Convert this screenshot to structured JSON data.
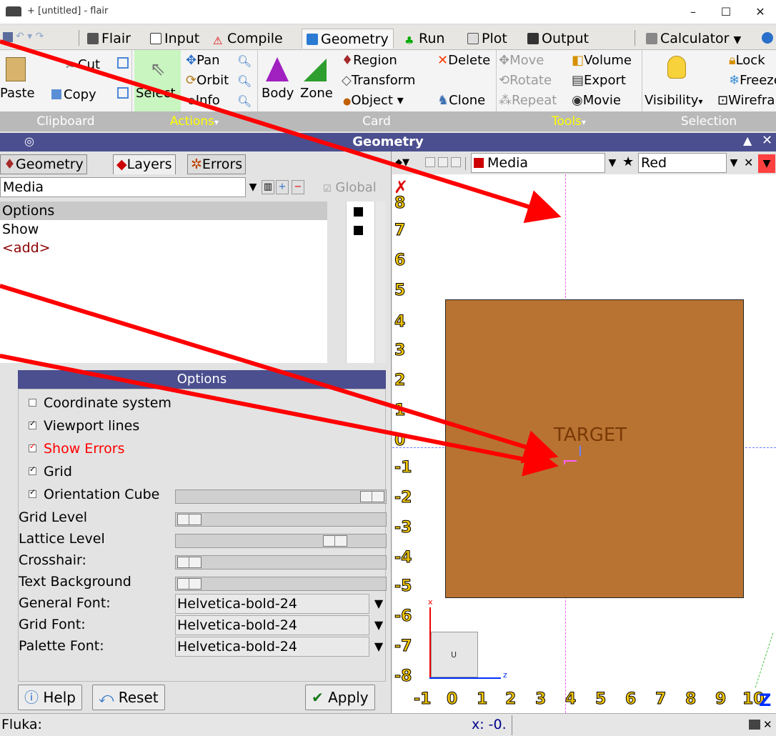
{
  "window": {
    "title": "+ [untitled] - flair",
    "minimize": "–",
    "maximize": "☐",
    "close": "✕"
  },
  "tabs": [
    {
      "label": "Flair"
    },
    {
      "label": "Input"
    },
    {
      "label": "Compile"
    },
    {
      "label": "Geometry",
      "active": true
    },
    {
      "label": "Run"
    },
    {
      "label": "Plot"
    },
    {
      "label": "Output"
    },
    {
      "label": "Calculator"
    }
  ],
  "ribbon": {
    "clipboard": {
      "paste": "Paste",
      "cut": "Cut",
      "copy": "Copy",
      "group": "Clipboard"
    },
    "actions": {
      "select": "Select",
      "pan": "Pan",
      "orbit": "Orbit",
      "info": "Info",
      "group": "Actions"
    },
    "card": {
      "body": "Body",
      "zone": "Zone",
      "region": "Region",
      "transform": "Transform",
      "object": "Object ▾",
      "delete": "Delete",
      "clone": "Clone",
      "group": "Card"
    },
    "tools": {
      "move": "Move",
      "rotate": "Rotate",
      "repeat": "Repeat",
      "volume": "Volume",
      "export": "Export",
      "movie": "Movie",
      "group": "Tools"
    },
    "selection": {
      "visibility": "Visibility",
      "lock": "Lock",
      "freeze": "Freeze",
      "wireframe": "Wirefra",
      "group": "Selection"
    }
  },
  "panel": {
    "title": "Geometry",
    "subtabs": [
      "Geometry",
      "Layers",
      "Errors"
    ],
    "layer_select": "Media",
    "global_label": "Global",
    "layer_items": [
      "Options",
      "Show",
      "<add>"
    ]
  },
  "options": {
    "header": "Options",
    "checks": [
      {
        "label": "Coordinate system",
        "checked": false
      },
      {
        "label": "Viewport lines",
        "checked": true
      },
      {
        "label": "Show Errors",
        "checked": true,
        "color": "#ff0000"
      },
      {
        "label": "Grid",
        "checked": true
      },
      {
        "label": "Orientation Cube",
        "checked": true
      }
    ],
    "sliders": [
      {
        "label": "Grid Level",
        "value": 0.0
      },
      {
        "label": "Lattice Level",
        "value": 0.75
      },
      {
        "label": "Crosshair:",
        "value": 0.0
      },
      {
        "label": "Text Background",
        "value": 0.0
      }
    ],
    "fonts": [
      {
        "label": "General Font:",
        "value": "Helvetica-bold-24"
      },
      {
        "label": "Grid Font:",
        "value": "Helvetica-bold-24"
      },
      {
        "label": "Palette Font:",
        "value": "Helvetica-bold-24"
      }
    ]
  },
  "buttons": {
    "help": "Help",
    "reset": "Reset",
    "apply": "Apply"
  },
  "viewport": {
    "layer": "Media",
    "color": "Red",
    "region_label": "TARGET",
    "region_color": "#b87333",
    "y_ticks": [
      "8",
      "7",
      "6",
      "5",
      "4",
      "3",
      "2",
      "1",
      "0",
      "-1",
      "-2",
      "-3",
      "-4",
      "-5",
      "-6",
      "-7",
      "-8"
    ],
    "x_ticks": [
      "-1",
      "0",
      "1",
      "2",
      "3",
      "4",
      "5",
      "6",
      "7",
      "8",
      "9",
      "10"
    ],
    "axis_x": "x",
    "axis_z": "z",
    "axis_u": "U",
    "axis_big": "Z"
  },
  "status": {
    "left": "Fluka:",
    "coord": "x: -0."
  }
}
